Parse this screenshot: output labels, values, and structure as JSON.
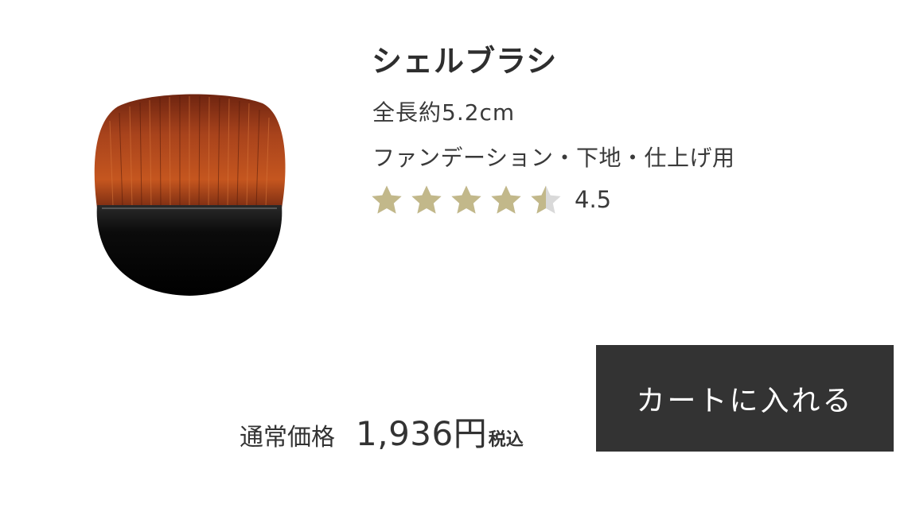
{
  "product": {
    "name": "シェルブラシ",
    "size": "全長約5.2cm",
    "usage": "ファンデーション・下地・仕上げ用",
    "image_icon": "shell-brush-image"
  },
  "rating": {
    "value": "4.5",
    "score": 4.5,
    "max": 5,
    "star_color": "#c2b88a",
    "empty_star_color": "#d9d9d9"
  },
  "price": {
    "label": "通常価格",
    "amount": "1,936",
    "currency": "円",
    "tax": "税込"
  },
  "cart": {
    "button_label": "カートに入れる",
    "button_color": "#333333"
  }
}
